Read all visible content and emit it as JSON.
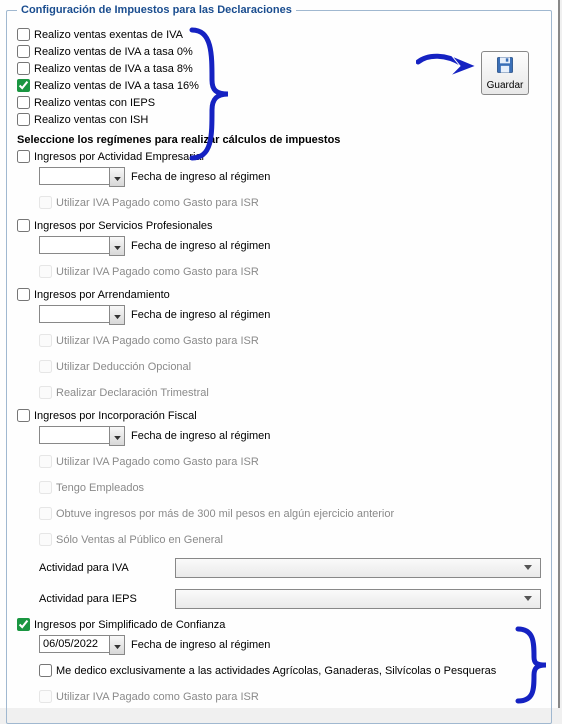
{
  "fieldset_title": "Configuración de Impuestos para las Declaraciones",
  "save_label": "Guardar",
  "sales": {
    "iva_exentas": "Realizo ventas exentas de IVA",
    "iva_0": "Realizo ventas de IVA a tasa 0%",
    "iva_8": "Realizo ventas de IVA a tasa 8%",
    "iva_16": "Realizo ventas de IVA a tasa 16%",
    "ieps": "Realizo ventas con IEPS",
    "ish": "Realizo ventas con ISH"
  },
  "section_title": "Seleccione los regímenes para realizar cálculos de impuestos",
  "date_label": "Fecha de ingreso al régimen",
  "iva_gasto_isr": "Utilizar IVA Pagado como Gasto para ISR",
  "regimen": {
    "empresarial": "Ingresos por Actividad Empresarial",
    "servicios": "Ingresos por Servicios Profesionales",
    "arrendamiento": "Ingresos por Arrendamiento",
    "arrend_deduccion": "Utilizar Deducción Opcional",
    "arrend_trimestral": "Realizar Declaración Trimestral",
    "incorporacion": "Ingresos por Incorporación Fiscal",
    "inc_empleados": "Tengo Empleados",
    "inc_300mil": "Obtuve ingresos por más de 300 mil pesos en algún ejercicio anterior",
    "inc_publico": "Sólo Ventas al Público en General",
    "act_iva_label": "Actividad para IVA",
    "act_ieps_label": "Actividad para IEPS",
    "simplificado": "Ingresos por Simplificado de Confianza",
    "simpl_date": "06/05/2022",
    "simpl_agricola": "Me dedico exclusivamente a las actividades Agrícolas, Ganaderas, Silvícolas o Pesqueras"
  }
}
